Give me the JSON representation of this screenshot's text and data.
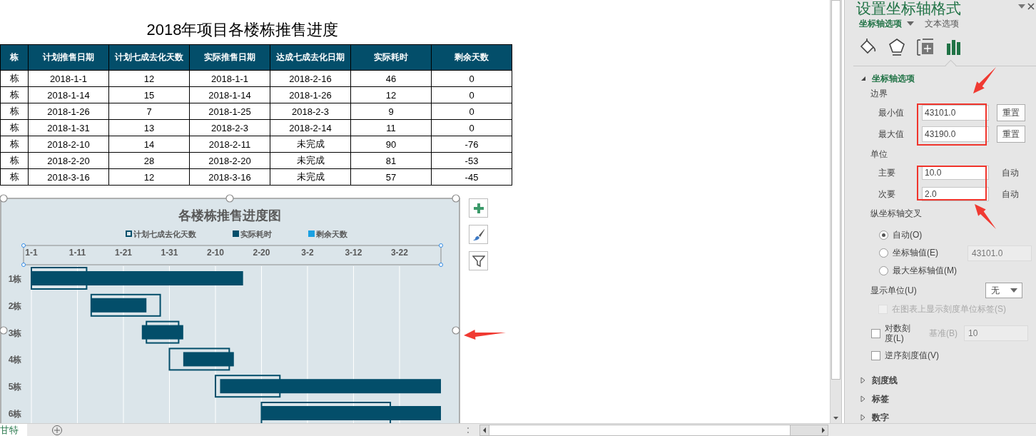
{
  "spreadsheet": {
    "title": "2018年项目各楼栋推售进度",
    "table": {
      "columns": [
        "栋",
        "计划推售日期",
        "计划七成去化天数",
        "实际推售日期",
        "达成七成去化日期",
        "实际耗时",
        "剩余天数"
      ],
      "rows": [
        [
          "栋",
          "2018-1-1",
          "12",
          "2018-1-1",
          "2018-2-16",
          "46",
          "0"
        ],
        [
          "栋",
          "2018-1-14",
          "15",
          "2018-1-14",
          "2018-1-26",
          "12",
          "0"
        ],
        [
          "栋",
          "2018-1-26",
          "7",
          "2018-1-25",
          "2018-2-3",
          "9",
          "0"
        ],
        [
          "栋",
          "2018-1-31",
          "13",
          "2018-2-3",
          "2018-2-14",
          "11",
          "0"
        ],
        [
          "栋",
          "2018-2-10",
          "14",
          "2018-2-11",
          "未完成",
          "90",
          "-76"
        ],
        [
          "栋",
          "2018-2-20",
          "28",
          "2018-2-20",
          "未完成",
          "81",
          "-53"
        ],
        [
          "栋",
          "2018-3-16",
          "12",
          "2018-3-16",
          "未完成",
          "57",
          "-45"
        ]
      ]
    },
    "chart": {
      "title": "各楼栋推售进度图",
      "legend": [
        {
          "label": "计划七成去化天数",
          "color": "#034e6a"
        },
        {
          "label": "实际耗时",
          "color": "#034e6a"
        },
        {
          "label": "剩余天数",
          "color": "#1ba1e2"
        }
      ],
      "axis_labels": [
        "1-1",
        "1-11",
        "1-21",
        "1-31",
        "2-10",
        "2-20",
        "3-2",
        "3-12",
        "3-22"
      ],
      "categories": [
        "1栋",
        "2栋",
        "3栋",
        "4栋",
        "5栋",
        "6栋"
      ]
    }
  },
  "sheet_tabs": [
    {
      "label": "甘特",
      "selected": true
    }
  ],
  "format_panel": {
    "title": "设置坐标轴格式",
    "tabs": [
      {
        "label": "坐标轴选项",
        "selected": true
      },
      {
        "label": "文本选项",
        "selected": false
      }
    ],
    "icon_tabs": [
      {
        "kind": "fill",
        "selected": false
      },
      {
        "kind": "effects",
        "selected": false
      },
      {
        "kind": "size",
        "selected": false
      },
      {
        "kind": "axis",
        "selected": true
      }
    ],
    "section": {
      "label": "坐标轴选项",
      "expanded": true
    },
    "bounds": {
      "label": "边界",
      "fields": [
        {
          "label": "最小值",
          "value": "43101.0",
          "button": "重置"
        },
        {
          "label": "最大值",
          "value": "43190.0",
          "button": "重置"
        }
      ]
    },
    "units": {
      "label": "单位",
      "fields": [
        {
          "label": "主要",
          "value": "10.0",
          "note": "自动"
        },
        {
          "label": "次要",
          "value": "2.0",
          "note": "自动"
        }
      ]
    },
    "crossing": {
      "label": "纵坐标轴交叉",
      "options": [
        {
          "label": "自动(O)",
          "selected": true
        },
        {
          "label": "坐标轴值(E)",
          "selected": false,
          "value": "43101.0"
        },
        {
          "label": "最大坐标轴值(M)",
          "selected": false
        }
      ]
    },
    "display_units": {
      "label": "显示单位(U)",
      "value": "无"
    },
    "checkboxes": [
      {
        "label": "在图表上显示刻度单位标签(S)",
        "checked": false,
        "disabled": true
      },
      {
        "label": "对数刻度(L)",
        "checked": false,
        "disabled": false,
        "base_label": "基准(B)",
        "base_value": "10"
      },
      {
        "label": "逆序刻度值(V)",
        "checked": false,
        "disabled": false
      }
    ],
    "collapsed_sections": [
      {
        "label": "刻度线",
        "expanded": false
      },
      {
        "label": "标签",
        "expanded": false
      },
      {
        "label": "数字",
        "expanded": false
      }
    ]
  }
}
